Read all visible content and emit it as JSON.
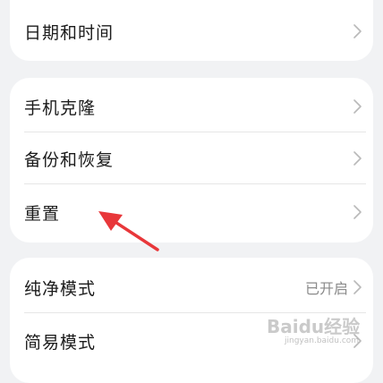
{
  "groups": [
    {
      "items": [
        {
          "label": "日期和时间"
        }
      ]
    },
    {
      "items": [
        {
          "label": "手机克隆"
        },
        {
          "label": "备份和恢复"
        },
        {
          "label": "重置"
        }
      ]
    },
    {
      "items": [
        {
          "label": "纯净模式",
          "value": "已开启"
        },
        {
          "label": "简易模式"
        }
      ]
    }
  ],
  "annotation": {
    "arrow_color": "#e8373a"
  },
  "watermark": {
    "logo_text": "Baidu经验",
    "url_text": "jingyan.baidu.com"
  },
  "colors": {
    "background": "#f1f2f4",
    "card": "#ffffff",
    "text": "#1b1b1b",
    "secondary": "#8a8a8a"
  }
}
